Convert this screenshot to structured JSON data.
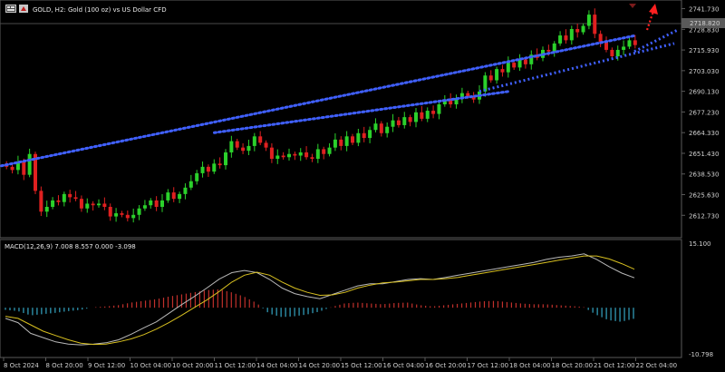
{
  "window": {
    "symbol_title": "GOLD, H2:  Gold (100 oz) vs US Dollar CFD",
    "icon": "chart-window-icon"
  },
  "price_panel": {
    "current_price_label": "2718.820",
    "colors": {
      "bull": "#2bd12b",
      "bear": "#e02020",
      "trendline": "#4060ff",
      "arrow": "#ff2020",
      "marker": "#7a1b1b",
      "background": "#000000",
      "axis": "#5a5a5a"
    }
  },
  "macd_panel": {
    "title": "MACD(12,26,9) 7.008 8.557 0.000 -3.098",
    "colors": {
      "hist_pos": "#c0302b",
      "hist_neg": "#35a6c4",
      "macd_line": "#b8b8b8",
      "signal_line": "#d8c020"
    }
  },
  "chart_data": [
    {
      "type": "candlestick",
      "title": "GOLD, H2:  Gold (100 oz) vs US Dollar CFD",
      "ylim": [
        2601.0,
        2746.0
      ],
      "yticks": [
        "2741.730",
        "2728.830",
        "2715.930",
        "2703.030",
        "2690.130",
        "2677.230",
        "2664.330",
        "2651.430",
        "2638.530",
        "2625.630",
        "2612.730"
      ],
      "xticks": [
        "8 Oct 2024",
        "8 Oct 20:00",
        "9 Oct 12:00",
        "10 Oct 04:00",
        "10 Oct 20:00",
        "11 Oct 12:00",
        "14 Oct 04:00",
        "14 Oct 20:00",
        "15 Oct 12:00",
        "16 Oct 04:00",
        "16 Oct 20:00",
        "17 Oct 12:00",
        "18 Oct 04:00",
        "18 Oct 20:00",
        "21 Oct 12:00",
        "22 Oct 04:00"
      ],
      "close_series": [
        2643,
        2641,
        2646,
        2638,
        2651,
        2628,
        2615,
        2618,
        2622,
        2621,
        2626,
        2624,
        2623,
        2617,
        2620,
        2619,
        2620,
        2618,
        2612,
        2614,
        2613,
        2611,
        2613,
        2617,
        2619,
        2622,
        2618,
        2622,
        2627,
        2623,
        2626,
        2630,
        2634,
        2639,
        2643,
        2640,
        2645,
        2644,
        2652,
        2659,
        2655,
        2653,
        2656,
        2662,
        2658,
        2655,
        2648,
        2650,
        2649,
        2651,
        2650,
        2652,
        2649,
        2648,
        2654,
        2651,
        2655,
        2660,
        2656,
        2662,
        2658,
        2664,
        2661,
        2666,
        2670,
        2664,
        2668,
        2672,
        2669,
        2674,
        2671,
        2677,
        2673,
        2678,
        2676,
        2682,
        2685,
        2682,
        2686,
        2689,
        2687,
        2685,
        2690,
        2700,
        2697,
        2704,
        2702,
        2708,
        2705,
        2710,
        2707,
        2713,
        2711,
        2716,
        2715,
        2720,
        2725,
        2722,
        2729,
        2727,
        2731,
        2738,
        2726,
        2721,
        2716,
        2712,
        2716,
        2718,
        2722,
        2719
      ],
      "trendlines": [
        {
          "from": [
            "11 Oct 12:00",
            2664.3
          ],
          "to": [
            "18 Oct 04:00",
            2690.1
          ]
        },
        {
          "from": [
            "15 Oct 04:00",
            2638.5
          ],
          "to": [
            "22 Oct 04:00",
            2725.0
          ]
        }
      ]
    },
    {
      "type": "line",
      "title": "MACD(12,26,9) 7.008 8.557 0.000 -3.098",
      "ylim": [
        -10.798,
        15.1
      ],
      "yticks": [
        "15.100",
        "-10.798"
      ],
      "series": [
        {
          "name": "MACD",
          "values": [
            -2.5,
            -3.5,
            -6,
            -7,
            -8,
            -8.5,
            -8.7,
            -8.5,
            -8.2,
            -7.5,
            -6.2,
            -4.7,
            -3.3,
            -1.3,
            0.7,
            2.6,
            4.6,
            6.7,
            8.2,
            8.7,
            8.2,
            6.6,
            4.6,
            3.3,
            2.6,
            2.1,
            3.1,
            4.1,
            5.1,
            5.6,
            5.6,
            6.1,
            6.6,
            6.8,
            6.6,
            7.1,
            7.6,
            8.1,
            8.6,
            9.1,
            9.6,
            10.1,
            10.6,
            11.3,
            11.8,
            12.1,
            12.6,
            11.3,
            9.6,
            8.1,
            7.0
          ]
        },
        {
          "name": "Signal",
          "values": [
            -2,
            -2.5,
            -4,
            -5.5,
            -6.5,
            -7.5,
            -8.3,
            -8.6,
            -8.5,
            -8.0,
            -7.3,
            -6.3,
            -5.0,
            -3.5,
            -1.8,
            0.0,
            1.8,
            3.8,
            6.0,
            7.6,
            8.3,
            7.6,
            6.0,
            4.6,
            3.6,
            2.9,
            3.0,
            3.6,
            4.6,
            5.3,
            5.8,
            6.0,
            6.3,
            6.6,
            6.6,
            6.8,
            7.1,
            7.6,
            8.1,
            8.6,
            9.1,
            9.6,
            10.1,
            10.6,
            11.1,
            11.6,
            12.1,
            12.1,
            11.4,
            10.3,
            9.0
          ]
        },
        {
          "name": "Histogram",
          "values": [
            -0.5,
            -0.8,
            -1.8,
            -1.5,
            -1.2,
            -0.8,
            -0.5,
            0.1,
            0.3,
            0.6,
            1.2,
            1.6,
            2.0,
            2.6,
            3.1,
            3.6,
            4.1,
            4.3,
            3.6,
            2.6,
            1.1,
            -1.4,
            -2.2,
            -2.0,
            -1.6,
            -0.9,
            0.2,
            1.0,
            1.2,
            1.0,
            0.8,
            1.1,
            1.2,
            0.6,
            0.3,
            0.6,
            0.9,
            1.2,
            1.5,
            1.6,
            1.3,
            1.0,
            0.8,
            0.8,
            0.6,
            0.4,
            0.2,
            -1.6,
            -2.9,
            -3.3,
            -2.6
          ]
        }
      ]
    }
  ]
}
